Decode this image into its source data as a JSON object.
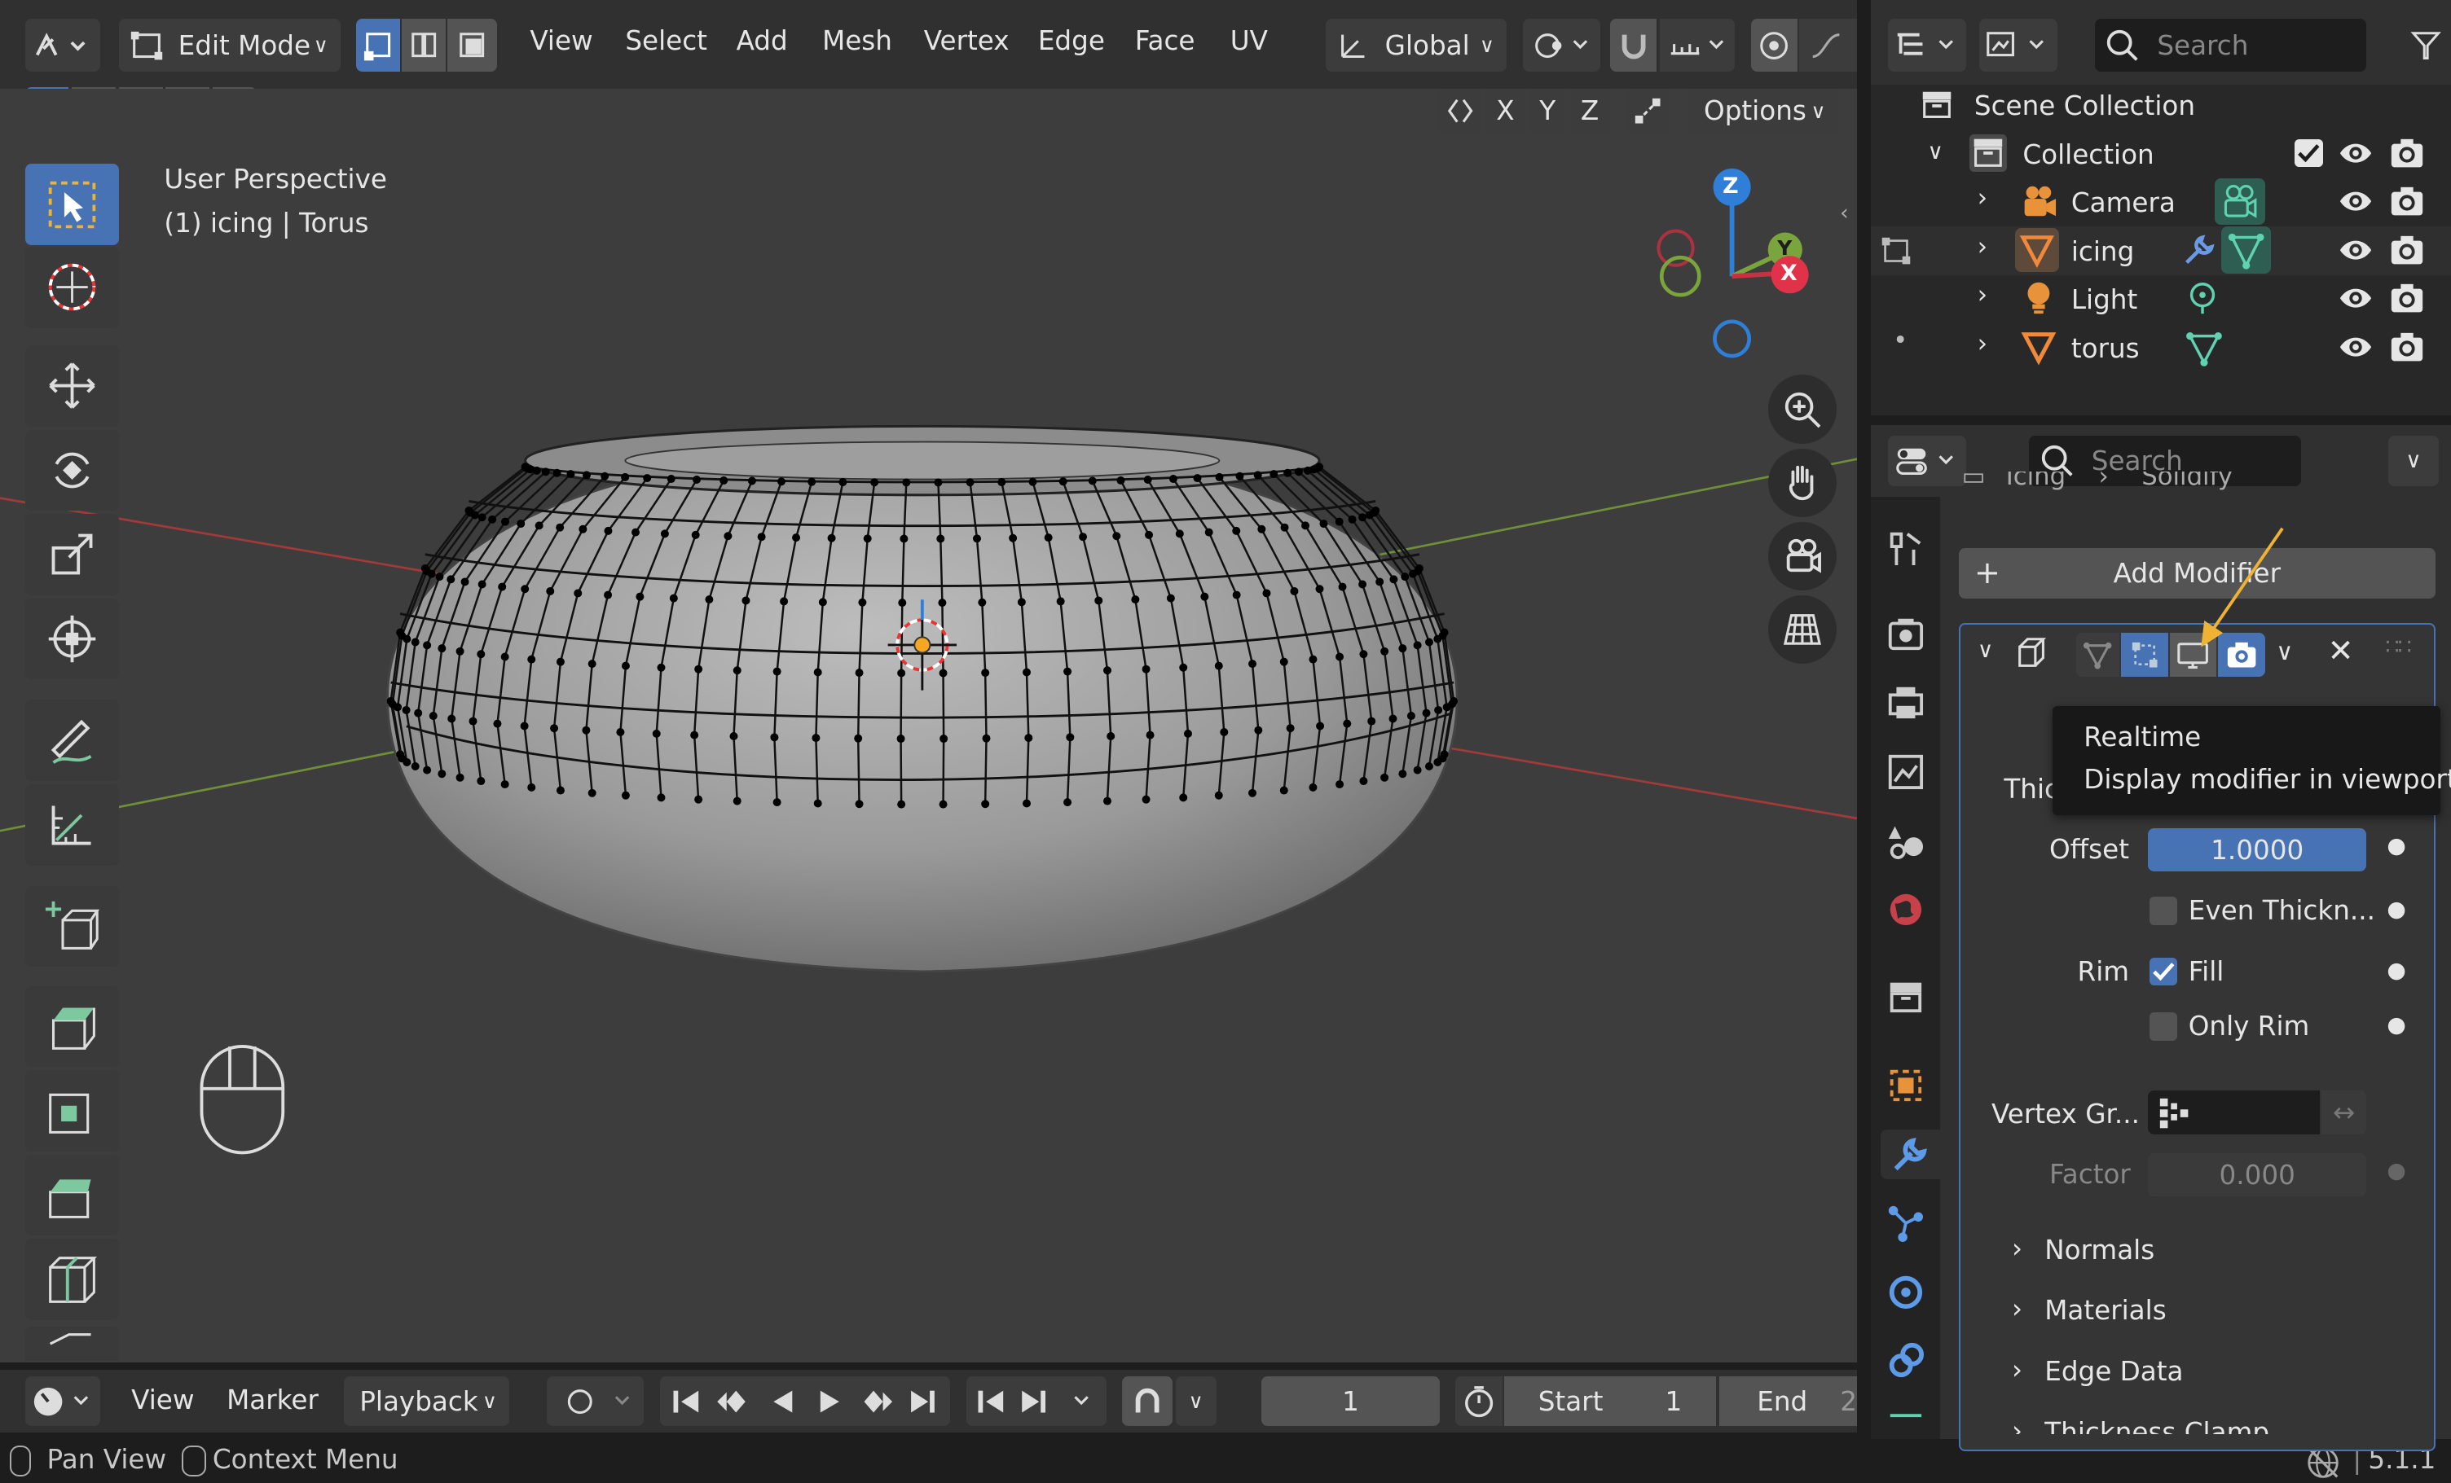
{
  "header": {
    "mode": "Edit Mode",
    "menus": [
      "View",
      "Select",
      "Add",
      "Mesh",
      "Vertex",
      "Edge",
      "Face",
      "UV"
    ],
    "orientation": "Global",
    "axes": [
      "X",
      "Y",
      "Z"
    ],
    "options": "Options"
  },
  "viewport": {
    "view_name": "User Perspective",
    "object_info_prefix": "(1) icing",
    "object_info_mesh": "Torus",
    "gizmo": {
      "z": "Z",
      "y": "Y",
      "x": "X"
    }
  },
  "timeline": {
    "menus": [
      "View",
      "Marker",
      "Playback"
    ],
    "current_frame": "1",
    "start_label": "Start",
    "start_value": "1",
    "end_label": "End",
    "end_value_partial": "2"
  },
  "statusbar": {
    "pan_view": "Pan View",
    "context_menu": "Context Menu",
    "version": "5.1.1"
  },
  "outliner": {
    "search_placeholder": "Search",
    "scene_collection": "Scene Collection",
    "collection": "Collection",
    "items": [
      {
        "name": "Camera"
      },
      {
        "name": "icing"
      },
      {
        "name": "Light"
      },
      {
        "name": "torus"
      }
    ]
  },
  "properties": {
    "search_placeholder": "Search",
    "breadcrumb_partial": [
      "Icing",
      "Solidify"
    ],
    "add_modifier": "Add Modifier",
    "thickness_label_partial": "Thic",
    "offset_label": "Offset",
    "offset_value": "1.0000",
    "even_thickness": "Even Thickn...",
    "rim_label": "Rim",
    "fill_label": "Fill",
    "only_rim_label": "Only Rim",
    "vertex_group_label": "Vertex Gr...",
    "factor_label": "Factor",
    "factor_value": "0.000",
    "subpanels": [
      "Normals",
      "Materials",
      "Edge Data",
      "Thickness Clamp"
    ]
  },
  "tooltip": {
    "title": "Realtime",
    "description": "Display modifier in viewport."
  },
  "colors": {
    "accent": "#4772b3",
    "panel": "#303030",
    "viewport": "#3d3d3d",
    "axis_x": "#c93040",
    "axis_y": "#7aa43c",
    "axis_z": "#2f7fd8",
    "arrow": "#f0b232"
  }
}
